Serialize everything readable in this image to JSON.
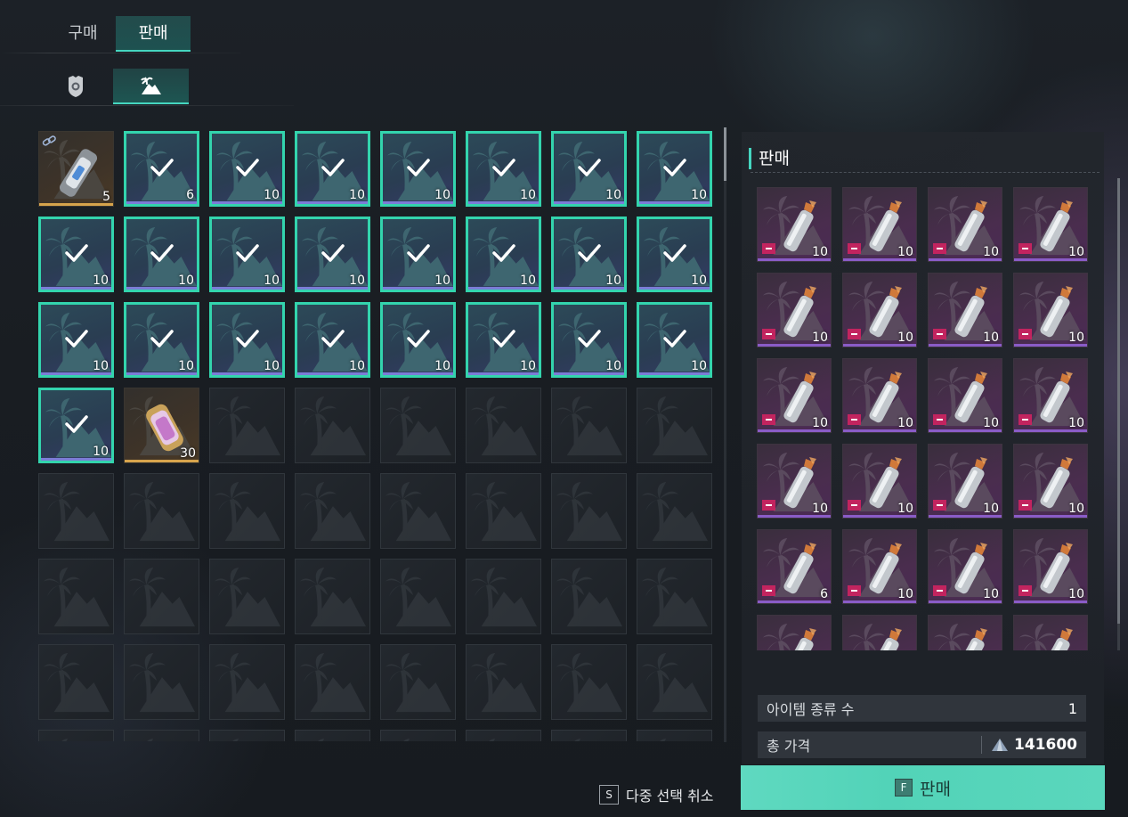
{
  "tabs": [
    {
      "label": "구매",
      "active": false
    },
    {
      "label": "판매",
      "active": true
    }
  ],
  "subtabs": [
    {
      "icon": "badge-icon",
      "active": false
    },
    {
      "icon": "island-icon",
      "active": true
    }
  ],
  "inventory": {
    "slots": [
      {
        "state": "orange",
        "qty": "5",
        "item": "capsule-item",
        "link": true
      },
      {
        "state": "selected",
        "qty": "6"
      },
      {
        "state": "selected",
        "qty": "10"
      },
      {
        "state": "selected",
        "qty": "10"
      },
      {
        "state": "selected",
        "qty": "10"
      },
      {
        "state": "selected",
        "qty": "10"
      },
      {
        "state": "selected",
        "qty": "10"
      },
      {
        "state": "selected",
        "qty": "10"
      },
      {
        "state": "selected",
        "qty": "10"
      },
      {
        "state": "selected",
        "qty": "10"
      },
      {
        "state": "selected",
        "qty": "10"
      },
      {
        "state": "selected",
        "qty": "10"
      },
      {
        "state": "selected",
        "qty": "10"
      },
      {
        "state": "selected",
        "qty": "10"
      },
      {
        "state": "selected",
        "qty": "10"
      },
      {
        "state": "selected",
        "qty": "10"
      },
      {
        "state": "selected",
        "qty": "10"
      },
      {
        "state": "selected",
        "qty": "10"
      },
      {
        "state": "selected",
        "qty": "10"
      },
      {
        "state": "selected",
        "qty": "10"
      },
      {
        "state": "selected",
        "qty": "10"
      },
      {
        "state": "selected",
        "qty": "10"
      },
      {
        "state": "selected",
        "qty": "10"
      },
      {
        "state": "selected",
        "qty": "10"
      },
      {
        "state": "selected",
        "qty": "10"
      },
      {
        "state": "orange",
        "qty": "30",
        "item": "vial-item"
      },
      {
        "state": "empty"
      },
      {
        "state": "empty"
      },
      {
        "state": "empty"
      },
      {
        "state": "empty"
      },
      {
        "state": "empty"
      },
      {
        "state": "empty"
      },
      {
        "state": "empty"
      },
      {
        "state": "empty"
      },
      {
        "state": "empty"
      },
      {
        "state": "empty"
      },
      {
        "state": "empty"
      },
      {
        "state": "empty"
      },
      {
        "state": "empty"
      },
      {
        "state": "empty"
      },
      {
        "state": "empty"
      },
      {
        "state": "empty"
      },
      {
        "state": "empty"
      },
      {
        "state": "empty"
      },
      {
        "state": "empty"
      },
      {
        "state": "empty"
      },
      {
        "state": "empty"
      },
      {
        "state": "empty"
      },
      {
        "state": "empty"
      },
      {
        "state": "empty"
      },
      {
        "state": "empty"
      },
      {
        "state": "empty"
      },
      {
        "state": "empty"
      },
      {
        "state": "empty"
      },
      {
        "state": "empty"
      },
      {
        "state": "empty"
      },
      {
        "state": "empty"
      },
      {
        "state": "empty"
      },
      {
        "state": "empty"
      },
      {
        "state": "empty"
      },
      {
        "state": "empty"
      },
      {
        "state": "empty"
      },
      {
        "state": "empty"
      },
      {
        "state": "empty"
      }
    ]
  },
  "sell_panel": {
    "title": "판매",
    "items": [
      "10",
      "10",
      "10",
      "10",
      "10",
      "10",
      "10",
      "10",
      "10",
      "10",
      "10",
      "10",
      "10",
      "10",
      "10",
      "10",
      "6",
      "10",
      "10",
      "10",
      "",
      "",
      "",
      ""
    ],
    "item_type_label": "아이템 종류 수",
    "item_type_value": "1",
    "total_label": "총 가격",
    "total_value": "141600",
    "currency_icon": "crystal-icon",
    "sell_key": "F",
    "sell_label": "판매"
  },
  "cancel_hint": {
    "key": "S",
    "label": "다중 선택 취소"
  },
  "colors": {
    "accent": "#45d6c0",
    "selected_border": "#33d4ad",
    "remove_badge": "#c2245f",
    "sell_button": "#5fd9c0"
  }
}
